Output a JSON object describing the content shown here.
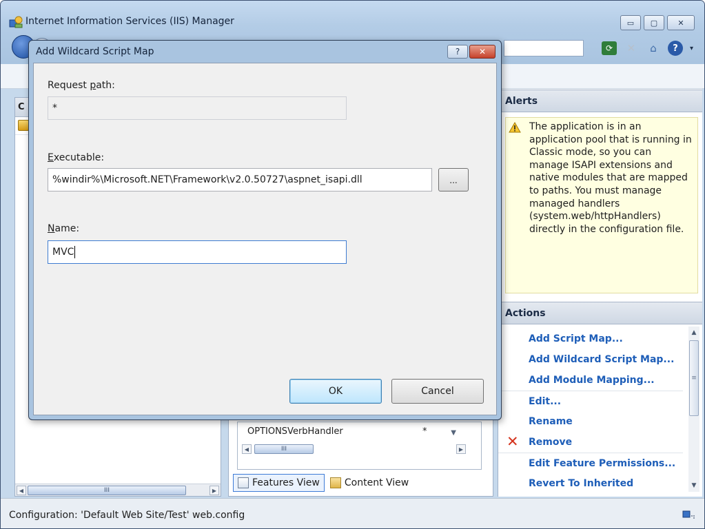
{
  "window": {
    "title": "Internet Information Services (IIS) Manager",
    "minimize": "▭",
    "maximize": "▢",
    "close": "✕"
  },
  "left_pane": {
    "header": "C",
    "hscroll_grip": "III"
  },
  "center_pane": {
    "grid_row": {
      "name": "OPTIONSVerbHandler",
      "path": "*"
    },
    "hscroll_grip": "III",
    "views": [
      {
        "label": "Features View",
        "active": true
      },
      {
        "label": "Content View",
        "active": false
      }
    ]
  },
  "right_pane": {
    "alerts_header": "Alerts",
    "alert_text": "The application is in an application pool that is running in Classic mode, so you can manage ISAPI extensions and native modules that are mapped to paths. You must manage managed handlers (system.web/httpHandlers) directly in the configuration file.",
    "actions_header": "Actions",
    "actions": [
      "Add Script Map...",
      "Add Wildcard Script Map...",
      "Add Module Mapping...",
      "Edit...",
      "Rename",
      "Remove",
      "Edit Feature Permissions...",
      "Revert To Inherited"
    ],
    "vscroll_grip": "≡"
  },
  "status": {
    "text": "Configuration: 'Default Web Site/Test' web.config"
  },
  "dialog": {
    "title": "Add Wildcard Script Map",
    "help": "?",
    "close": "✕",
    "request_path": {
      "label_pre": "Request ",
      "label_accel": "p",
      "label_post": "ath:",
      "value": "*"
    },
    "executable": {
      "label_pre": "",
      "label_accel": "E",
      "label_post": "xecutable:",
      "value": "%windir%\\Microsoft.NET\\Framework\\v2.0.50727\\aspnet_isapi.dll",
      "browse": "..."
    },
    "name": {
      "label_pre": "",
      "label_accel": "N",
      "label_post": "ame:",
      "value": "MVC"
    },
    "ok": "OK",
    "cancel": "Cancel"
  }
}
